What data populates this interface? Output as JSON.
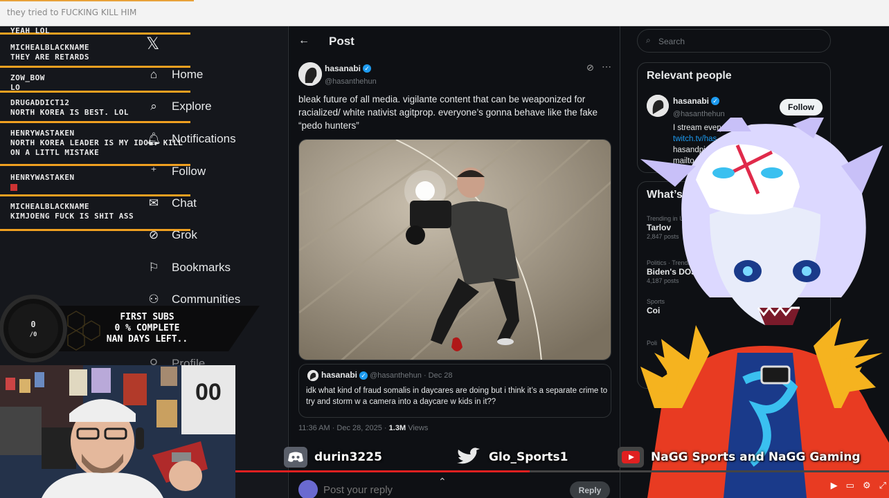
{
  "browser": {
    "tab_text": "they tried to FUCKING KILL HIM"
  },
  "chat": {
    "messages": [
      {
        "user": "",
        "text": "yeah lol"
      },
      {
        "user": "michealblackname",
        "text": "they are retards"
      },
      {
        "user": "zow_bow",
        "text": "lo"
      },
      {
        "user": "drugaddict12",
        "text": "north korea is best. lol"
      },
      {
        "user": "henrywastaken",
        "text": "north korea leader is my idol. kill on a littl mistake"
      },
      {
        "user": "henrywastaken",
        "text": ""
      },
      {
        "user": "michealblackname",
        "text": "kimjoeng fuck is shit ass"
      }
    ]
  },
  "nav": {
    "items": [
      {
        "label": "Home",
        "icon": "home-icon"
      },
      {
        "label": "Explore",
        "icon": "search-icon"
      },
      {
        "label": "Notifications",
        "icon": "bell-icon"
      },
      {
        "label": "Follow",
        "icon": "person-add-icon"
      },
      {
        "label": "Chat",
        "icon": "mail-icon"
      },
      {
        "label": "Grok",
        "icon": "grok-icon"
      },
      {
        "label": "Bookmarks",
        "icon": "bookmark-icon"
      },
      {
        "label": "Communities",
        "icon": "people-icon"
      },
      {
        "label": "Profile",
        "icon": "person-icon"
      }
    ]
  },
  "subs_widget": {
    "count": "0",
    "goal": "/0",
    "line1": "FIRST SUBS",
    "line2": "0 % COMPLETE",
    "line3": "NAN DAYS LEFT.."
  },
  "post": {
    "header_title": "Post",
    "author_name": "hasanabi",
    "author_handle": "@hasanthehun",
    "text": "bleak future of all media. vigilante content that can be weaponized for racialized/ white nativist agitprop. everyone’s gonna behave like the fake “pedo hunters”",
    "quote": {
      "author_name": "hasanabi",
      "author_handle": "@hasanthehun",
      "date": "· Dec 28",
      "text": "idk what kind of fraud somalis in daycares are doing but i think it’s a separate crime to try and storm w a camera into a daycare w kids in it??"
    },
    "time": "11:36 AM · Dec 28, 2025 ·",
    "views_count": "1.3M",
    "views_label": "Views",
    "reply_placeholder": "Post your reply",
    "reply_button": "Reply"
  },
  "sidebar": {
    "search_placeholder": "Search",
    "relevant_title": "Relevant people",
    "person": {
      "name": "hasanabi",
      "handle": "@hasanthehun",
      "follow_label": "Follow",
      "bio1": "I stream everyday on",
      "bio2": "twitch.tv/has",
      "bio3": "hasandpi",
      "bio4": "mailto"
    },
    "trends_title": "What’s h",
    "trends": [
      {
        "context": "Trending in U",
        "name": "Tarlov",
        "posts": "2,847 posts"
      },
      {
        "context": "Politics · Trendi",
        "name": "Biden's DOJ",
        "posts": "4,187 posts"
      },
      {
        "context": "Sports",
        "name": "Coi",
        "posts": ""
      },
      {
        "context": "Poli",
        "name": "",
        "posts": ""
      }
    ]
  },
  "overlay": {
    "discord": "durin3225",
    "twitter": "Glo_Sports1",
    "youtube": "NaGG Sports and NaGG Gaming",
    "progress": 0.45
  },
  "colors": {
    "accent": "#1d9bf0",
    "chat_border": "#f0a020",
    "progress": "#e02020"
  }
}
